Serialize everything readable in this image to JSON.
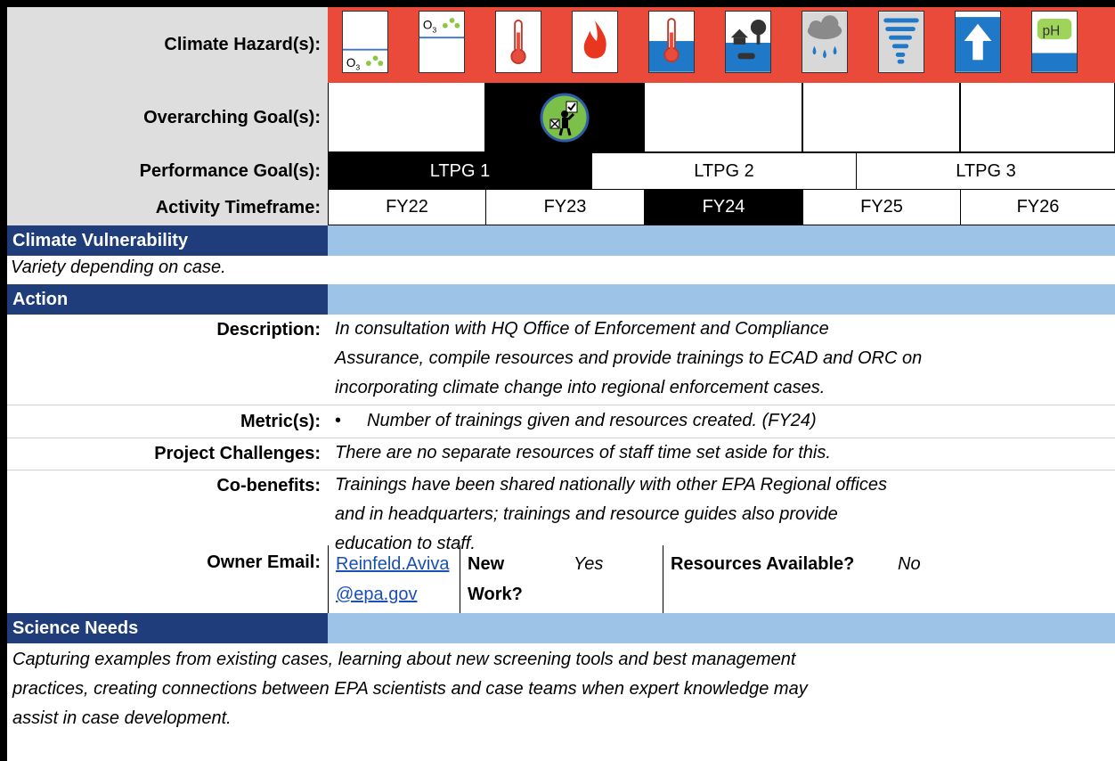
{
  "labels": {
    "hazards": "Climate Hazard(s):",
    "goals": "Overarching Goal(s):",
    "performance": "Performance Goal(s):",
    "timeframe": "Activity Timeframe:"
  },
  "hazard_icons": [
    "ozone-low-icon",
    "ozone-high-icon",
    "thermometer-icon",
    "fire-icon",
    "water-temperature-icon",
    "flooding-icon",
    "rain-icon",
    "tornado-icon",
    "sea-level-rise-icon",
    "ph-icon"
  ],
  "performance_goals": [
    {
      "label": "LTPG 1",
      "active": true
    },
    {
      "label": "LTPG 2",
      "active": false
    },
    {
      "label": "LTPG 3",
      "active": false
    }
  ],
  "timeframe": [
    {
      "label": "FY22",
      "active": false
    },
    {
      "label": "FY23",
      "active": false
    },
    {
      "label": "FY24",
      "active": true
    },
    {
      "label": "FY25",
      "active": false
    },
    {
      "label": "FY26",
      "active": false
    }
  ],
  "sections": {
    "vulnerability": "Climate Vulnerability",
    "action": "Action",
    "science": "Science Needs"
  },
  "vulnerability_text": "Variety depending on case.",
  "fields": {
    "description_label": "Description:",
    "description_lines": [
      "In consultation with HQ Office of Enforcement and Compliance",
      "Assurance, compile resources and provide trainings to ECAD and ORC on",
      "incorporating climate change into regional enforcement cases."
    ],
    "metrics_label": "Metric(s):",
    "metrics_bullet": "•",
    "metrics_text": "Number of trainings given and resources created. (FY24)",
    "challenges_label": "Project Challenges:",
    "challenges_text": "There are no separate resources of staff time set aside for this.",
    "cobenefits_label": "Co-benefits:",
    "cobenefits_lines": [
      "Trainings have been shared nationally with other EPA Regional offices",
      "and in headquarters; trainings and resource guides also provide",
      "education to staff."
    ],
    "owner_label": "Owner Email:",
    "owner_email_line1": "Reinfeld.Aviva",
    "owner_email_line2": "@epa.gov",
    "new_work_label": "New Work?",
    "new_work_value": "Yes",
    "resources_label": "Resources Available?",
    "resources_value": "No"
  },
  "science_lines": [
    "Capturing examples from existing cases, learning about new screening tools and best management",
    "practices, creating connections between EPA scientists and case teams when expert knowledge may",
    "assist in case development."
  ],
  "colors": {
    "hazard_bg": "#ea4a3a",
    "section_dark": "#1f3d7a",
    "section_light": "#9dc3e6",
    "link": "#1a4fb8"
  }
}
